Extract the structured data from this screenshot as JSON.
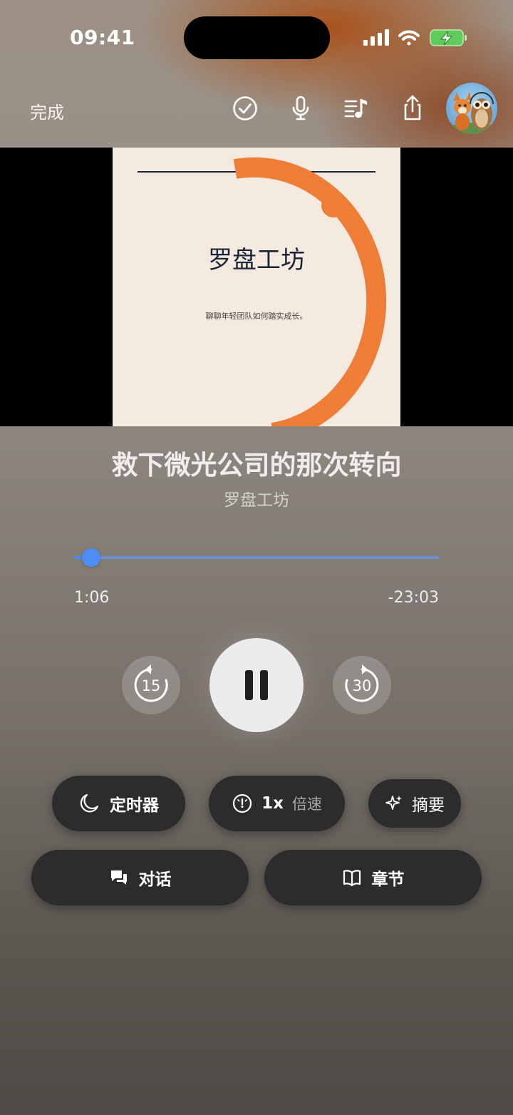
{
  "status_bar": {
    "time": "09:41"
  },
  "header": {
    "done_label": "完成"
  },
  "icons": {
    "check": "checkmark-circle-icon",
    "mic": "microphone-icon",
    "queue": "music-queue-icon",
    "share": "share-icon",
    "avatar": "avatar-fox-owl"
  },
  "cover": {
    "title": "罗盘工坊",
    "subtitle": "聊聊年轻团队如何踏实成长。",
    "accent_color": "#ee7d38",
    "background_color": "#f5eadf"
  },
  "episode": {
    "title": "救下微光公司的那次转向",
    "show": "罗盘工坊"
  },
  "playback": {
    "elapsed": "1:06",
    "remaining": "-23:03",
    "progress_fraction": 0.046,
    "skip_back_seconds": "15",
    "skip_forward_seconds": "30",
    "state": "playing"
  },
  "actions": {
    "timer_label": "定时器",
    "speed_value": "1x",
    "speed_label": "倍速",
    "summary_label": "摘要",
    "transcript_label": "对话",
    "chapters_label": "章节"
  },
  "colors": {
    "progress": "#4f8cf5",
    "pill_bg": "#2c2c2c"
  }
}
